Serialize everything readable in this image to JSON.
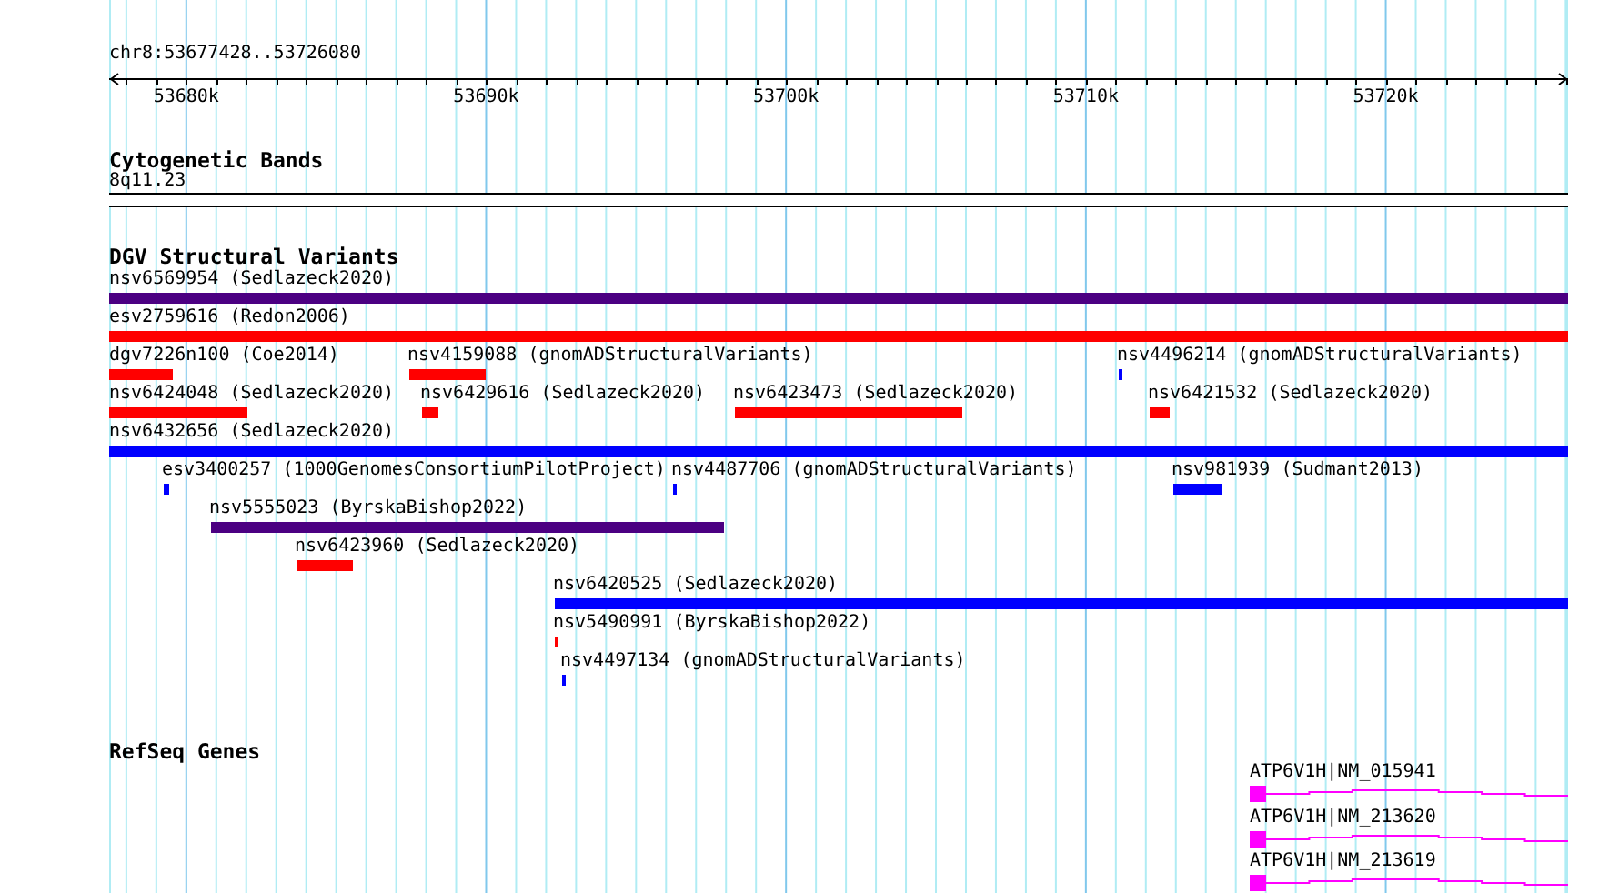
{
  "view": {
    "location": "chr8:53677428..53726080"
  },
  "ruler": {
    "ticks": [
      "53680k",
      "53690k",
      "53700k",
      "53710k",
      "53720k"
    ]
  },
  "tracks": [
    {
      "kind": "cytoband",
      "title": "Cytogenetic Bands",
      "bands": [
        {
          "label": "8q11.23"
        }
      ]
    },
    {
      "kind": "variants",
      "title": "DGV Structural Variants",
      "rows": [
        [
          {
            "label": "nsv6569954 (Sedlazeck2020)",
            "color": "#4b0082"
          }
        ],
        [
          {
            "label": "esv2759616 (Redon2006)",
            "color": "#ff0000"
          }
        ],
        [
          {
            "label": "dgv7226n100 (Coe2014)",
            "color": "#ff0000"
          },
          {
            "label": "nsv4159088 (gnomADStructuralVariants)",
            "color": "#ff0000"
          },
          {
            "label": "nsv4496214 (gnomADStructuralVariants)",
            "color": "#0000ff"
          }
        ],
        [
          {
            "label": "nsv6424048 (Sedlazeck2020)",
            "color": "#ff0000"
          },
          {
            "label": "nsv6429616 (Sedlazeck2020)",
            "color": "#ff0000"
          },
          {
            "label": "nsv6423473 (Sedlazeck2020)",
            "color": "#ff0000"
          },
          {
            "label": "nsv6421532 (Sedlazeck2020)",
            "color": "#ff0000"
          }
        ],
        [
          {
            "label": "nsv6432656 (Sedlazeck2020)",
            "color": "#0000ff"
          }
        ],
        [
          {
            "label": "esv3400257 (1000GenomesConsortiumPilotProject)",
            "color": "#0000ff"
          },
          {
            "label": "nsv4487706 (gnomADStructuralVariants)",
            "color": "#0000ff"
          },
          {
            "label": "nsv981939 (Sudmant2013)",
            "color": "#0000ff"
          }
        ],
        [
          {
            "label": "nsv5555023 (ByrskaBishop2022)",
            "color": "#4b0082"
          }
        ],
        [
          {
            "label": "nsv6423960 (Sedlazeck2020)",
            "color": "#ff0000"
          }
        ],
        [
          {
            "label": "nsv6420525 (Sedlazeck2020)",
            "color": "#0000ff"
          }
        ],
        [
          {
            "label": "nsv5490991 (ByrskaBishop2022)",
            "color": "#ff0000"
          }
        ],
        [
          {
            "label": "nsv4497134 (gnomADStructuralVariants)",
            "color": "#0000ff"
          }
        ]
      ]
    },
    {
      "kind": "genes",
      "title": "RefSeq Genes",
      "rows": [
        [
          {
            "label": "ATP6V1H|NM_015941"
          }
        ],
        [
          {
            "label": "ATP6V1H|NM_213620"
          }
        ],
        [
          {
            "label": "ATP6V1H|NM_213619"
          }
        ]
      ]
    }
  ]
}
